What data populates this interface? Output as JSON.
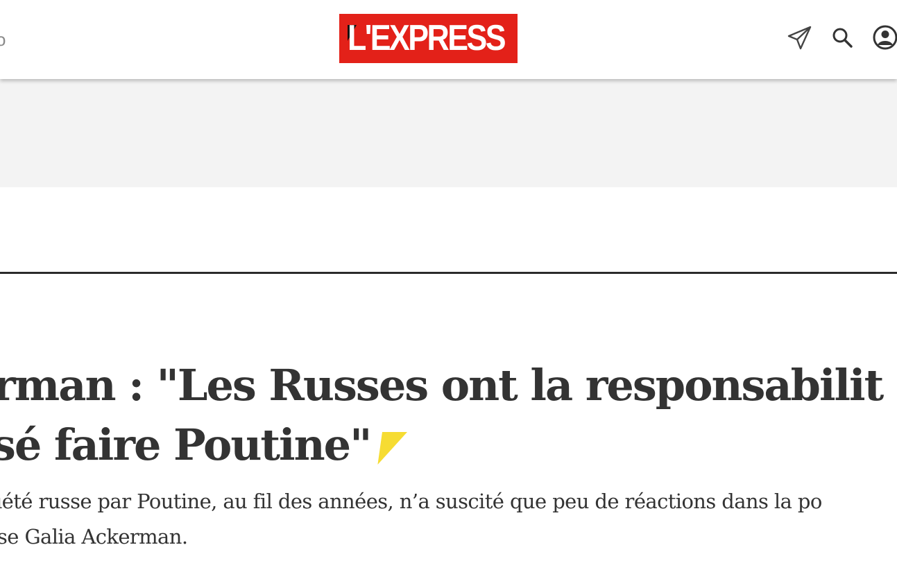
{
  "header": {
    "left_fragment": "o",
    "logo_text": "L'EXPRESS",
    "icons": {
      "send": "send-icon",
      "search": "search-icon",
      "account": "account-icon"
    }
  },
  "ad": {
    "background": "#f3f3f3"
  },
  "article": {
    "headline_lines": [
      "rman : \"Les Russes ont la responsabilit",
      "sé faire Poutine\""
    ],
    "lead_lines": [
      "iété russe par Poutine, au fil des années, n’a suscité que peu de réactions dans la po",
      "se Galia Ackerman."
    ],
    "premium_icon": "premium-triangle-icon"
  },
  "colors": {
    "brand_red": "#e32119",
    "premium_yellow": "#f6dc32",
    "text_dark": "#333333",
    "rule": "#2b2b2b"
  }
}
